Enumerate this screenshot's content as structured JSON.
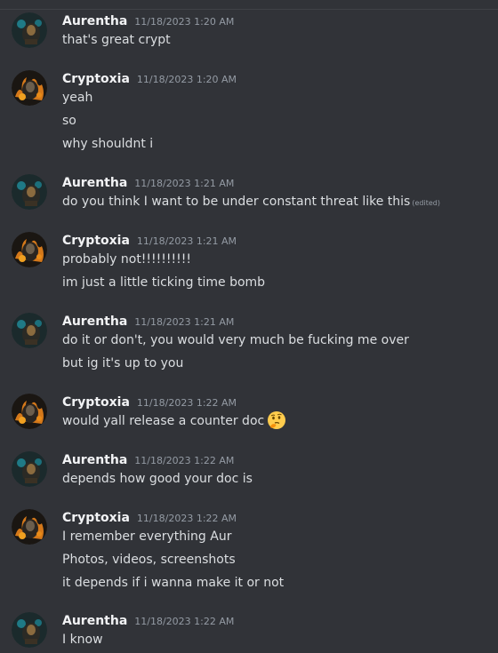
{
  "messages": [
    {
      "author": "Aurentha",
      "avatar": "aurentha-avatar",
      "timestamp": "11/18/2023 1:20 AM",
      "lines": [
        "that's great crypt"
      ]
    },
    {
      "author": "Cryptoxia",
      "avatar": "cryptoxia-avatar",
      "timestamp": "11/18/2023 1:20 AM",
      "lines": [
        "yeah",
        "so",
        "why shouldnt i"
      ]
    },
    {
      "author": "Aurentha",
      "avatar": "aurentha-avatar",
      "timestamp": "11/18/2023 1:21 AM",
      "lines": [
        "do you think I want to be under constant threat like this"
      ],
      "edited_label": "(edited)"
    },
    {
      "author": "Cryptoxia",
      "avatar": "cryptoxia-avatar",
      "timestamp": "11/18/2023 1:21 AM",
      "lines": [
        "probably not!!!!!!!!!!",
        "im just a little ticking time bomb"
      ]
    },
    {
      "author": "Aurentha",
      "avatar": "aurentha-avatar",
      "timestamp": "11/18/2023 1:21 AM",
      "lines": [
        "do it or don't, you would very much be fucking me over",
        "but ig it's up to you"
      ]
    },
    {
      "author": "Cryptoxia",
      "avatar": "cryptoxia-avatar",
      "timestamp": "11/18/2023 1:22 AM",
      "lines": [
        "would yall release a counter doc"
      ],
      "emoji": "thinking-face-emoji"
    },
    {
      "author": "Aurentha",
      "avatar": "aurentha-avatar",
      "timestamp": "11/18/2023 1:22 AM",
      "lines": [
        "depends how good your doc is"
      ]
    },
    {
      "author": "Cryptoxia",
      "avatar": "cryptoxia-avatar",
      "timestamp": "11/18/2023 1:22 AM",
      "lines": [
        "I remember everything Aur",
        "Photos, videos, screenshots",
        "it depends if i wanna make it or not"
      ]
    },
    {
      "author": "Aurentha",
      "avatar": "aurentha-avatar",
      "timestamp": "11/18/2023 1:22 AM",
      "lines": [
        "I know"
      ]
    }
  ],
  "colors": {
    "background": "#313338",
    "author": "#f2f3f5",
    "text": "#dbdee1",
    "timestamp": "#949ba4"
  }
}
